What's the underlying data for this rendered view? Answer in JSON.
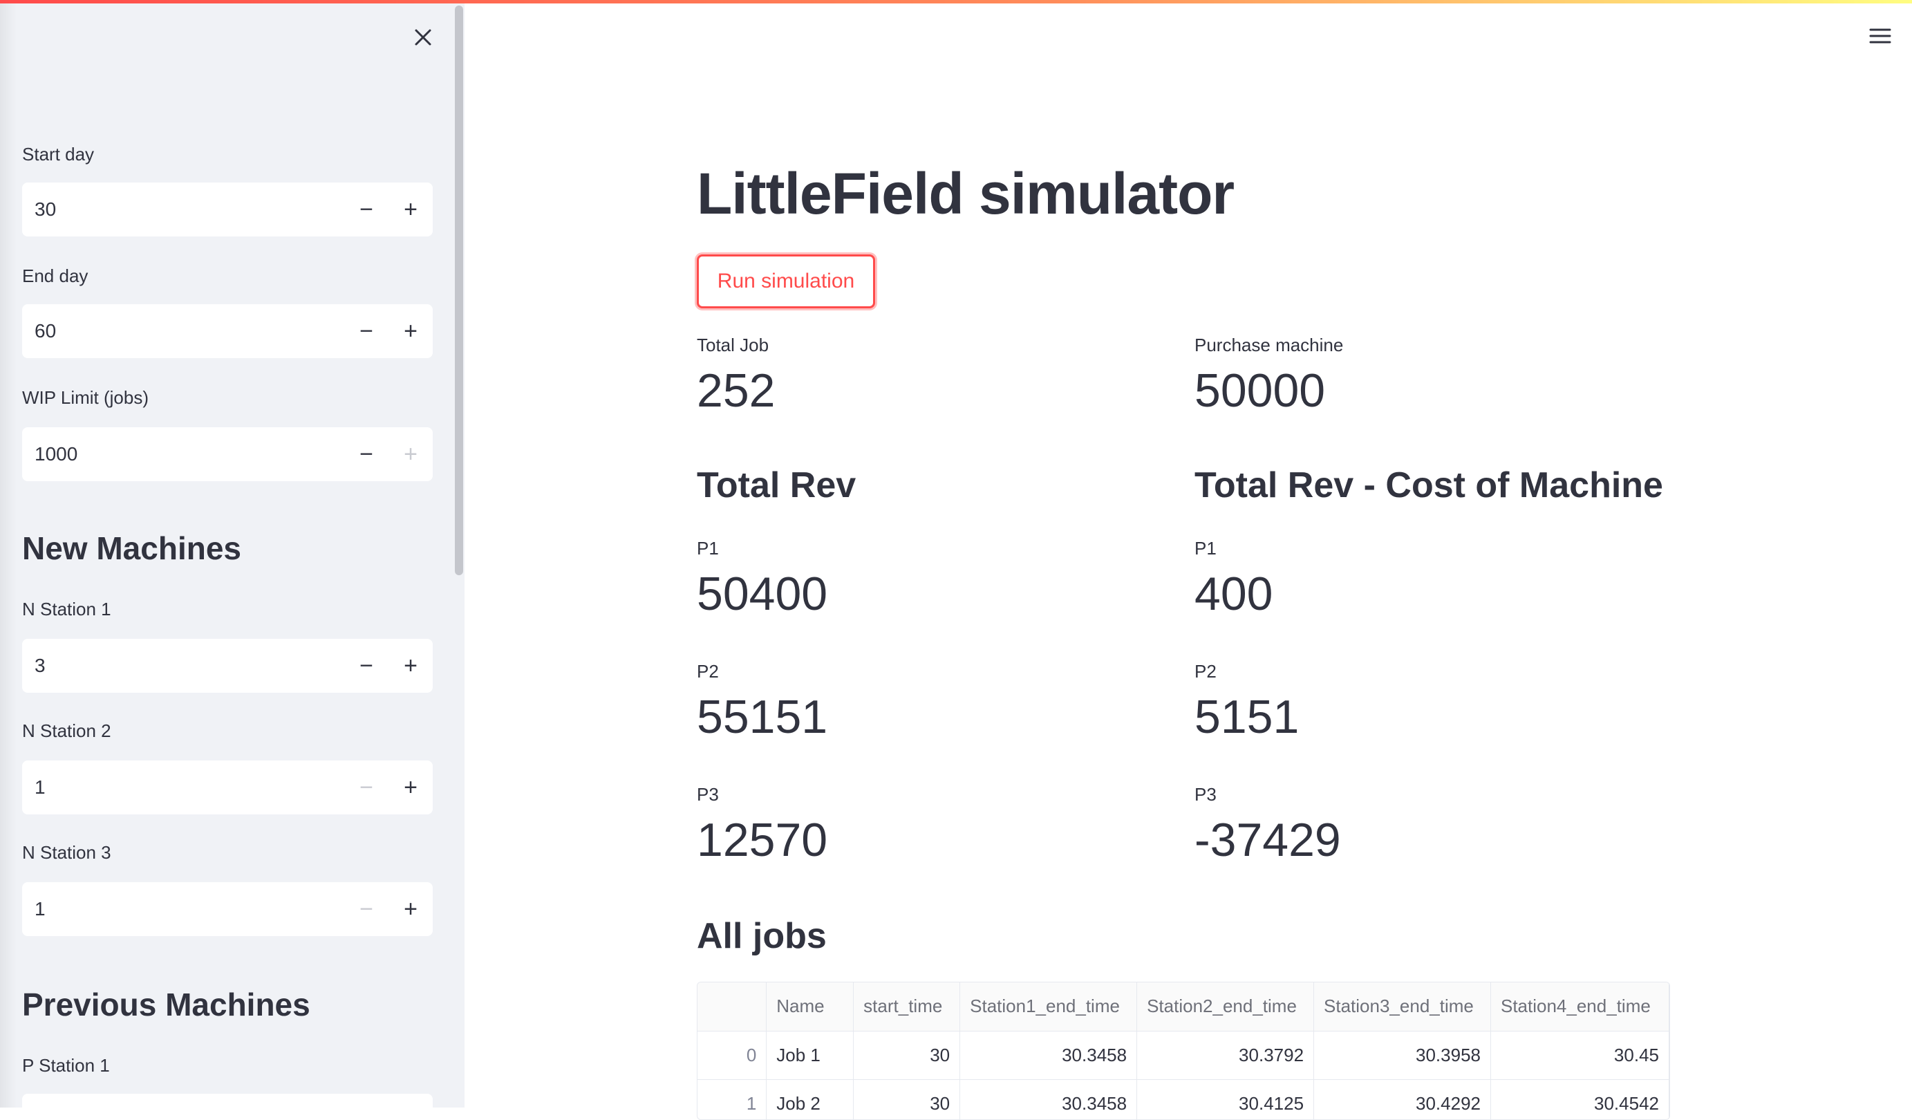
{
  "sidebar": {
    "start_day": {
      "label": "Start day",
      "value": "30"
    },
    "end_day": {
      "label": "End day",
      "value": "60"
    },
    "wip_limit": {
      "label": "WIP Limit (jobs)",
      "value": "1000"
    },
    "new_machines_heading": "New Machines",
    "n_station_1": {
      "label": "N Station 1",
      "value": "3"
    },
    "n_station_2": {
      "label": "N Station 2",
      "value": "1"
    },
    "n_station_3": {
      "label": "N Station 3",
      "value": "1"
    },
    "previous_machines_heading": "Previous Machines",
    "p_station_1": {
      "label": "P Station 1"
    },
    "minus_glyph": "−",
    "plus_glyph": "+"
  },
  "main": {
    "title": "LittleField simulator",
    "run_button": "Run simulation",
    "total_job": {
      "label": "Total Job",
      "value": "252"
    },
    "purchase_machine": {
      "label": "Purchase machine",
      "value": "50000"
    },
    "total_rev_heading": "Total Rev",
    "total_rev_minus_heading": "Total Rev - Cost of Machine",
    "total_rev": [
      {
        "label": "P1",
        "value": "50400"
      },
      {
        "label": "P2",
        "value": "55151"
      },
      {
        "label": "P3",
        "value": "12570"
      }
    ],
    "net_rev": [
      {
        "label": "P1",
        "value": "400"
      },
      {
        "label": "P2",
        "value": "5151"
      },
      {
        "label": "P3",
        "value": "-37429"
      }
    ],
    "all_jobs_heading": "All jobs",
    "table": {
      "columns": [
        "",
        "Name",
        "start_time",
        "Station1_end_time",
        "Station2_end_time",
        "Station3_end_time",
        "Station4_end_time"
      ],
      "rows": [
        [
          "0",
          "Job 1",
          "30",
          "30.3458",
          "30.3792",
          "30.3958",
          "30.45"
        ],
        [
          "1",
          "Job 2",
          "30",
          "30.3458",
          "30.4125",
          "30.4292",
          "30.4542"
        ]
      ]
    }
  },
  "icons": {
    "close": "close-icon",
    "menu": "hamburger-menu-icon"
  },
  "colors": {
    "accent": "#ff4b4b",
    "sidebar_bg": "#f0f2f6",
    "text": "#31333f"
  }
}
